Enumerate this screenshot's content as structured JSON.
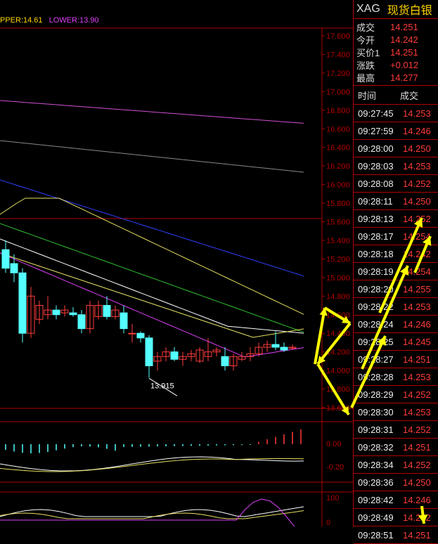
{
  "header": {
    "symbol": "XAG",
    "name": "现货白银",
    "legend_upper": "PPER:14.61",
    "legend_lower": "LOWER:13.90"
  },
  "quote": {
    "rows": [
      {
        "label": "成交",
        "value": "14.251"
      },
      {
        "label": "今开",
        "value": "14.242"
      },
      {
        "label": "买价1",
        "value": "14.251"
      },
      {
        "label": "涨跌",
        "value": "+0.012"
      },
      {
        "label": "最高",
        "value": "14.277"
      }
    ]
  },
  "ticks": {
    "header_time": "时间",
    "header_price": "成交",
    "rows": [
      {
        "time": "09:27:45",
        "price": "14.253"
      },
      {
        "time": "09:27:59",
        "price": "14.246"
      },
      {
        "time": "09:28:00",
        "price": "14.250"
      },
      {
        "time": "09:28:03",
        "price": "14.253"
      },
      {
        "time": "09:28:08",
        "price": "14.252"
      },
      {
        "time": "09:28:11",
        "price": "14.250"
      },
      {
        "time": "09:28:13",
        "price": "14.252"
      },
      {
        "time": "09:28:17",
        "price": "14.254"
      },
      {
        "time": "09:28:18",
        "price": "14.242"
      },
      {
        "time": "09:28:19",
        "price": "14.254"
      },
      {
        "time": "09:28:20",
        "price": "14.255"
      },
      {
        "time": "09:28:22",
        "price": "14.253"
      },
      {
        "time": "09:28:24",
        "price": "14.246"
      },
      {
        "time": "09:28:25",
        "price": "14.245"
      },
      {
        "time": "09:28:27",
        "price": "14.251"
      },
      {
        "time": "09:28:28",
        "price": "14.253"
      },
      {
        "time": "09:28:29",
        "price": "14.252"
      },
      {
        "time": "09:28:30",
        "price": "14.253"
      },
      {
        "time": "09:28:31",
        "price": "14.252"
      },
      {
        "time": "09:28:32",
        "price": "14.251"
      },
      {
        "time": "09:28:34",
        "price": "14.252"
      },
      {
        "time": "09:28:36",
        "price": "14.250"
      },
      {
        "time": "09:28:42",
        "price": "14.246"
      },
      {
        "time": "09:28:49",
        "price": "14.252"
      },
      {
        "time": "09:28:51",
        "price": "14.251"
      }
    ]
  },
  "chart_data": {
    "type": "candlestick",
    "price_axis": [
      "17.600",
      "17.400",
      "17.200",
      "17.000",
      "16.800",
      "16.600",
      "16.400",
      "16.200",
      "16.000",
      "15.800",
      "15.600",
      "15.400",
      "15.200",
      "15.000",
      "14.800",
      "14.600",
      "14.400",
      "14.200",
      "14.000",
      "13.800",
      "13.600"
    ],
    "low_label": "13.915",
    "macd_axis": [
      "0.00",
      "-0.20"
    ],
    "kdj_axis": [
      "100",
      "0"
    ],
    "candles": [
      {
        "o": 15.3,
        "h": 15.4,
        "l": 15.05,
        "c": 15.1
      },
      {
        "o": 15.15,
        "h": 15.25,
        "l": 14.95,
        "c": 15.05
      },
      {
        "o": 15.05,
        "h": 15.1,
        "l": 14.3,
        "c": 14.4
      },
      {
        "o": 14.4,
        "h": 14.9,
        "l": 14.35,
        "c": 14.8
      },
      {
        "o": 14.55,
        "h": 14.75,
        "l": 14.5,
        "c": 14.7
      },
      {
        "o": 14.6,
        "h": 14.8,
        "l": 14.55,
        "c": 14.65
      },
      {
        "o": 14.65,
        "h": 14.7,
        "l": 14.55,
        "c": 14.6
      },
      {
        "o": 14.62,
        "h": 14.7,
        "l": 14.58,
        "c": 14.65
      },
      {
        "o": 14.62,
        "h": 14.68,
        "l": 14.58,
        "c": 14.6
      },
      {
        "o": 14.6,
        "h": 14.65,
        "l": 14.4,
        "c": 14.45
      },
      {
        "o": 14.45,
        "h": 14.75,
        "l": 14.4,
        "c": 14.7
      },
      {
        "o": 14.58,
        "h": 14.75,
        "l": 14.55,
        "c": 14.7
      },
      {
        "o": 14.7,
        "h": 14.8,
        "l": 14.55,
        "c": 14.58
      },
      {
        "o": 14.58,
        "h": 14.7,
        "l": 14.55,
        "c": 14.65
      },
      {
        "o": 14.62,
        "h": 14.7,
        "l": 14.4,
        "c": 14.45
      },
      {
        "o": 14.4,
        "h": 14.5,
        "l": 14.3,
        "c": 14.4
      },
      {
        "o": 14.4,
        "h": 14.42,
        "l": 14.3,
        "c": 14.35
      },
      {
        "o": 14.35,
        "h": 14.38,
        "l": 13.92,
        "c": 14.05
      },
      {
        "o": 14.1,
        "h": 14.2,
        "l": 14.0,
        "c": 14.15
      },
      {
        "o": 14.15,
        "h": 14.25,
        "l": 14.1,
        "c": 14.2
      },
      {
        "o": 14.2,
        "h": 14.25,
        "l": 14.1,
        "c": 14.12
      },
      {
        "o": 14.12,
        "h": 14.2,
        "l": 14.05,
        "c": 14.15
      },
      {
        "o": 14.15,
        "h": 14.22,
        "l": 14.1,
        "c": 14.18
      },
      {
        "o": 14.1,
        "h": 14.25,
        "l": 14.08,
        "c": 14.22
      },
      {
        "o": 14.15,
        "h": 14.35,
        "l": 14.1,
        "c": 14.2
      },
      {
        "o": 14.2,
        "h": 14.25,
        "l": 14.15,
        "c": 14.22
      },
      {
        "o": 14.15,
        "h": 14.25,
        "l": 14.0,
        "c": 14.05
      },
      {
        "o": 14.05,
        "h": 14.18,
        "l": 14.0,
        "c": 14.15
      },
      {
        "o": 14.12,
        "h": 14.2,
        "l": 14.1,
        "c": 14.15
      },
      {
        "o": 14.15,
        "h": 14.25,
        "l": 14.1,
        "c": 14.18
      },
      {
        "o": 14.18,
        "h": 14.3,
        "l": 14.15,
        "c": 14.25
      },
      {
        "o": 14.25,
        "h": 14.32,
        "l": 14.2,
        "c": 14.28
      },
      {
        "o": 14.28,
        "h": 14.42,
        "l": 14.22,
        "c": 14.25
      },
      {
        "o": 14.25,
        "h": 14.3,
        "l": 14.2,
        "c": 14.22
      },
      {
        "o": 14.24,
        "h": 14.28,
        "l": 14.22,
        "c": 14.25
      }
    ]
  },
  "colors": {
    "up": "#ff3b3b",
    "down": "#54ffff",
    "axis_red": "#b00000",
    "annotation": "#ffff00"
  }
}
